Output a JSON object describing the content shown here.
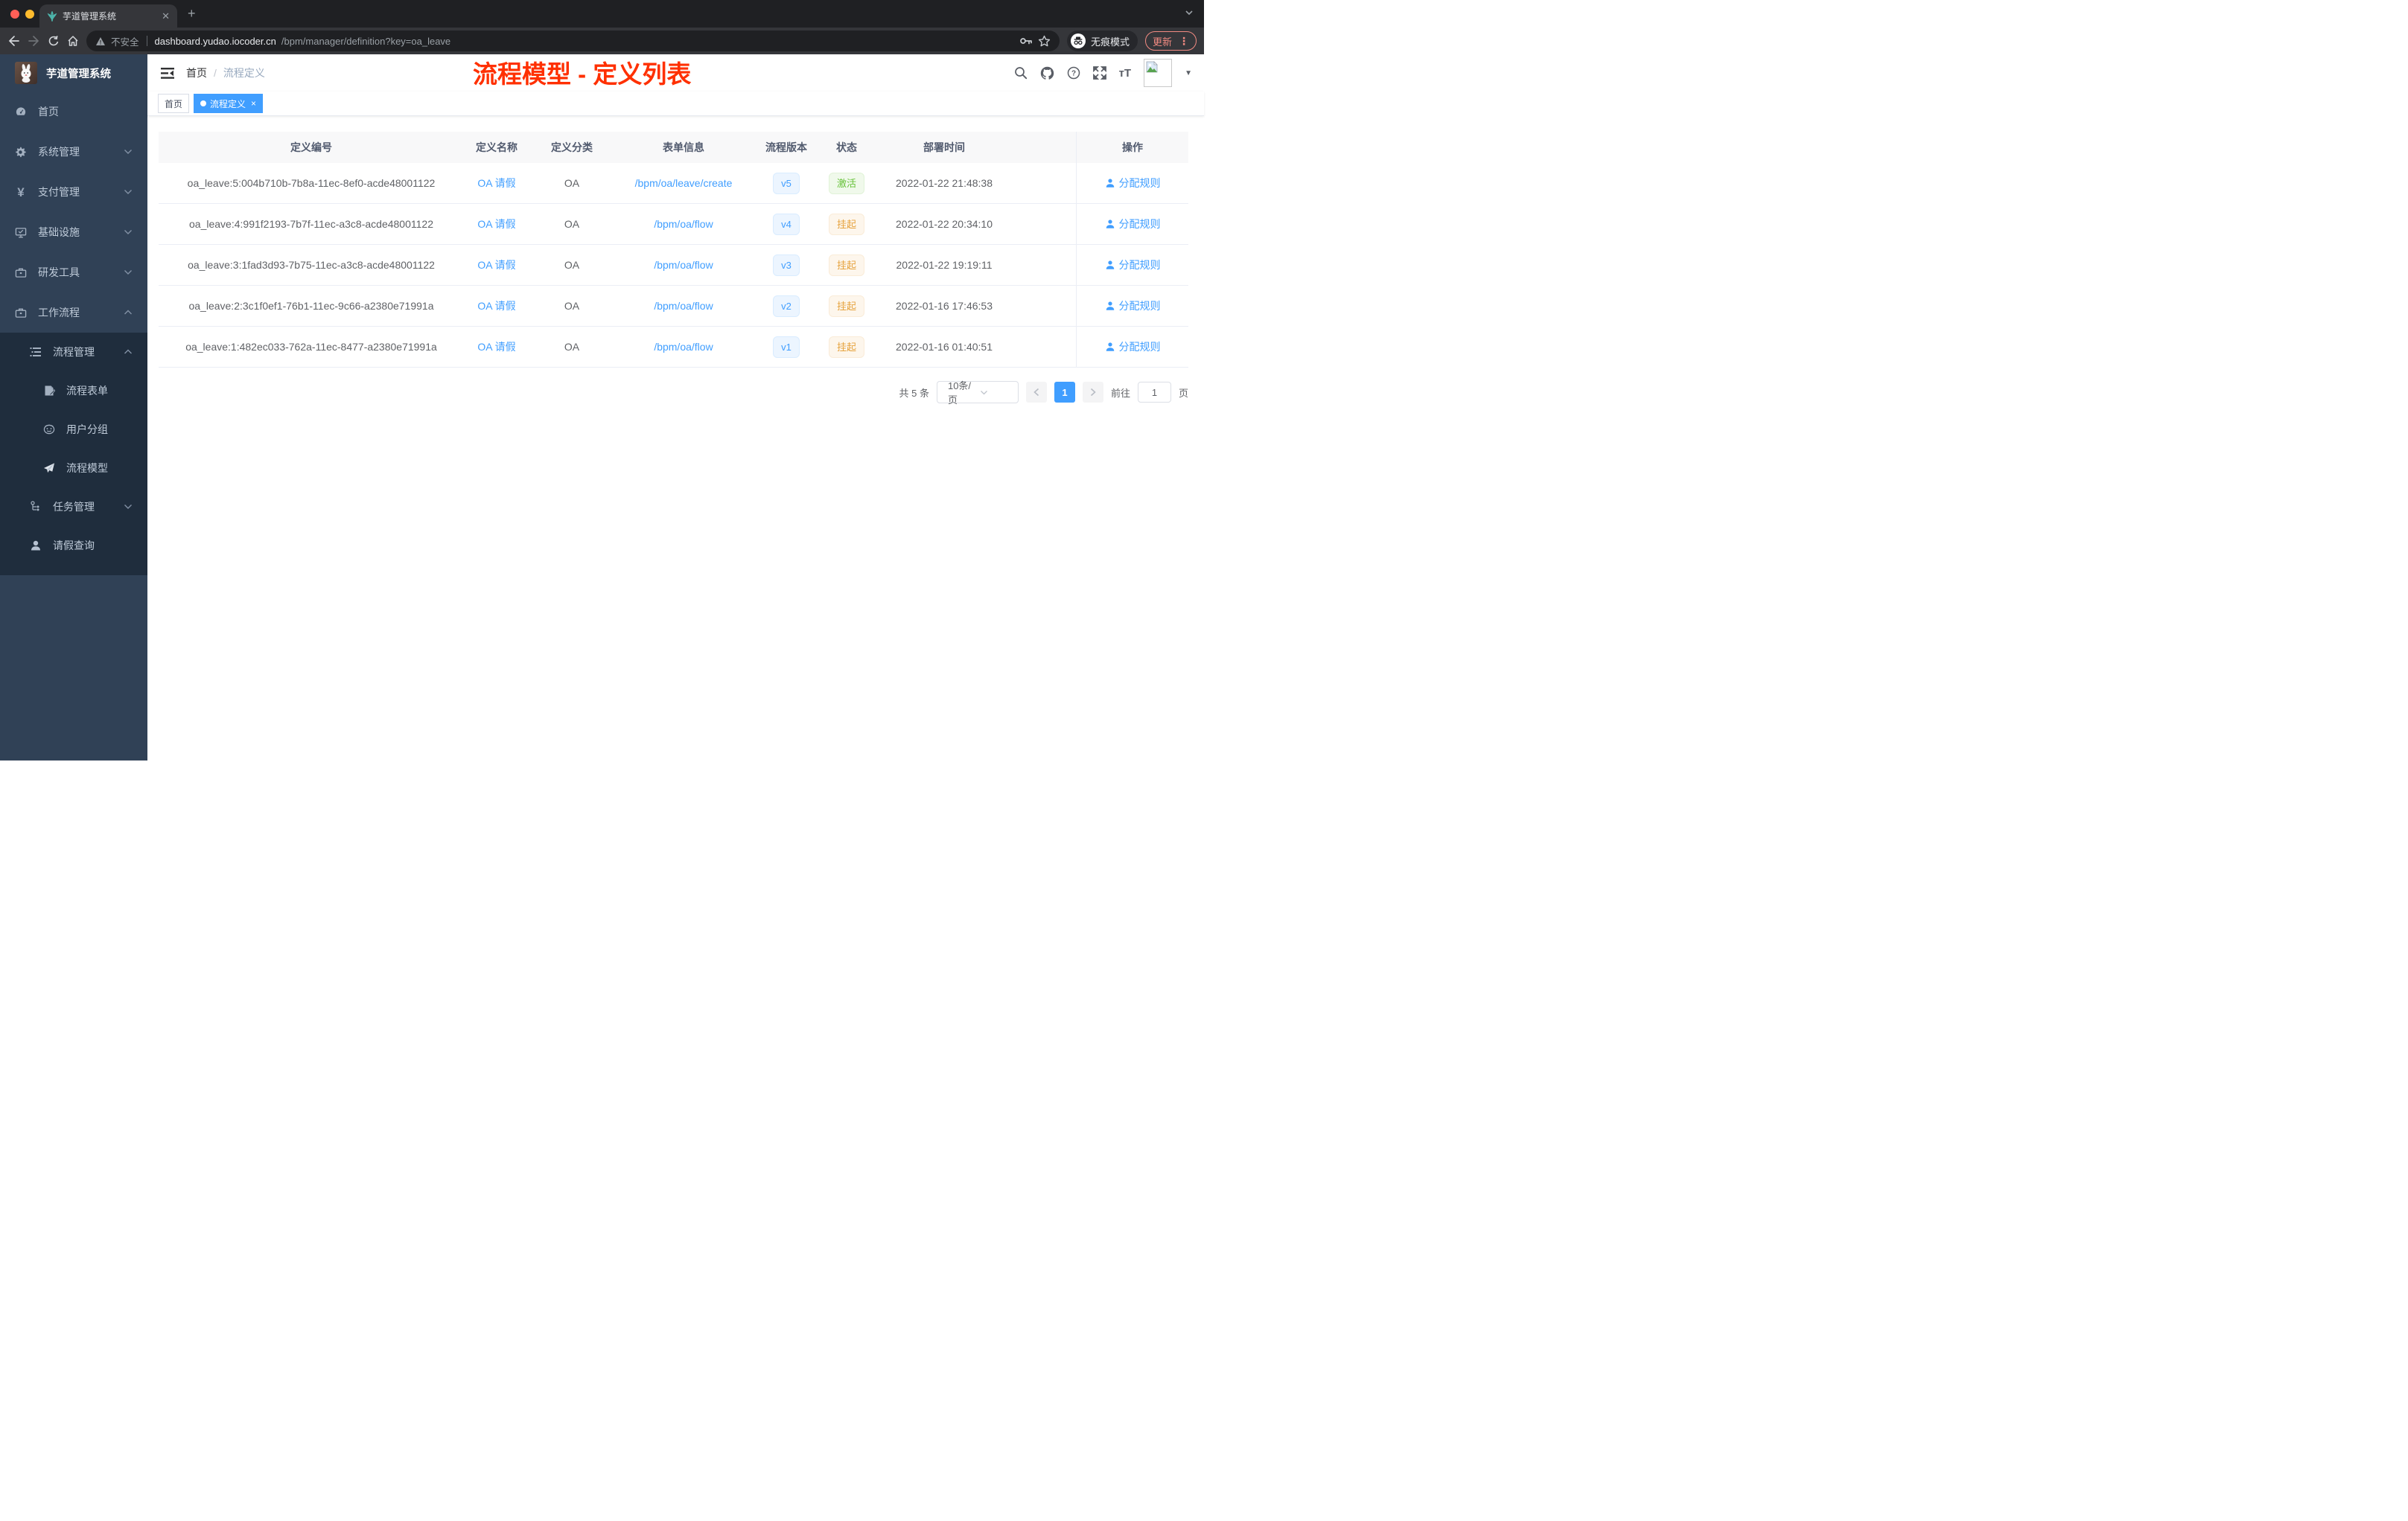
{
  "browser": {
    "tab_title": "芋道管理系统",
    "new_tab": "+",
    "close_tab": "✕",
    "security_label": "不安全",
    "url_host": "dashboard.yudao.iocoder.cn",
    "url_path": "/bpm/manager/definition?key=oa_leave",
    "incognito_label": "无痕模式",
    "update_label": "更新"
  },
  "sidebar": {
    "title": "芋道管理系统",
    "items": [
      {
        "label": "首页"
      },
      {
        "label": "系统管理"
      },
      {
        "label": "支付管理"
      },
      {
        "label": "基础设施"
      },
      {
        "label": "研发工具"
      },
      {
        "label": "工作流程"
      },
      {
        "label": "流程管理"
      },
      {
        "label": "流程表单"
      },
      {
        "label": "用户分组"
      },
      {
        "label": "流程模型"
      },
      {
        "label": "任务管理"
      },
      {
        "label": "请假查询"
      }
    ]
  },
  "header": {
    "breadcrumb_home": "首页",
    "breadcrumb_separator": "/",
    "breadcrumb_current": "流程定义",
    "overlay_title": "流程模型 - 定义列表"
  },
  "tags": {
    "home_label": "首页",
    "active_label": "流程定义",
    "close": "×"
  },
  "table": {
    "columns": {
      "id": "定义编号",
      "name": "定义名称",
      "category": "定义分类",
      "form": "表单信息",
      "version": "流程版本",
      "status": "状态",
      "deploy_time": "部署时间",
      "actions": "操作"
    },
    "rows": [
      {
        "id": "oa_leave:5:004b710b-7b8a-11ec-8ef0-acde48001122",
        "name": "OA 请假",
        "category": "OA",
        "form": "/bpm/oa/leave/create",
        "version": "v5",
        "status": "激活",
        "time": "2022-01-22 21:48:38",
        "action": "分配规则"
      },
      {
        "id": "oa_leave:4:991f2193-7b7f-11ec-a3c8-acde48001122",
        "name": "OA 请假",
        "category": "OA",
        "form": "/bpm/oa/flow",
        "version": "v4",
        "status": "挂起",
        "time": "2022-01-22 20:34:10",
        "action": "分配规则"
      },
      {
        "id": "oa_leave:3:1fad3d93-7b75-11ec-a3c8-acde48001122",
        "name": "OA 请假",
        "category": "OA",
        "form": "/bpm/oa/flow",
        "version": "v3",
        "status": "挂起",
        "time": "2022-01-22 19:19:11",
        "action": "分配规则"
      },
      {
        "id": "oa_leave:2:3c1f0ef1-76b1-11ec-9c66-a2380e71991a",
        "name": "OA 请假",
        "category": "OA",
        "form": "/bpm/oa/flow",
        "version": "v2",
        "status": "挂起",
        "time": "2022-01-16 17:46:53",
        "action": "分配规则"
      },
      {
        "id": "oa_leave:1:482ec033-762a-11ec-8477-a2380e71991a",
        "name": "OA 请假",
        "category": "OA",
        "form": "/bpm/oa/flow",
        "version": "v1",
        "status": "挂起",
        "time": "2022-01-16 01:40:51",
        "action": "分配规则"
      }
    ]
  },
  "pagination": {
    "total": "共 5 条",
    "page_size": "10条/页",
    "current_page": "1",
    "goto_label": "前往",
    "goto_value": "1",
    "page_unit": "页"
  },
  "colors": {
    "accent_blue": "#409eff",
    "success_green": "#67c23a",
    "warning_orange": "#e6a23c",
    "overlay_red": "#ff3000",
    "update_red": "#f28b82",
    "sidebar_bg": "#304156",
    "submenu_bg": "#1f2d3d"
  }
}
